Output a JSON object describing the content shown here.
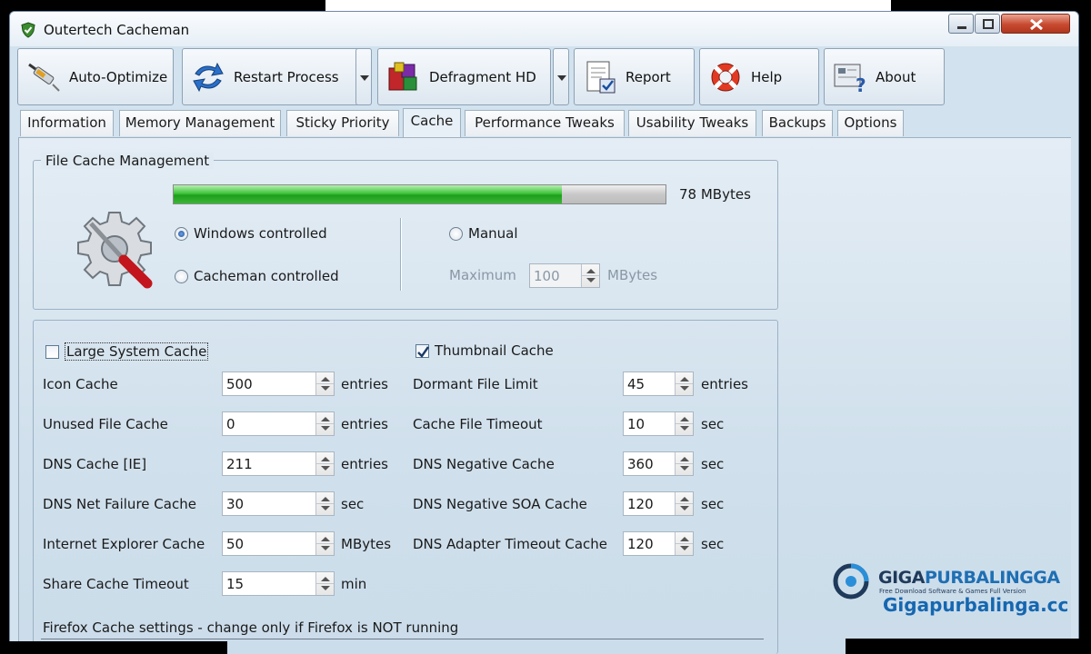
{
  "window": {
    "title": "Outertech Cacheman"
  },
  "toolbar": {
    "auto_optimize": "Auto-Optimize",
    "restart_process": "Restart Process",
    "defragment_hd": "Defragment HD",
    "report": "Report",
    "help": "Help",
    "about": "About"
  },
  "tabs": [
    {
      "label": "Information"
    },
    {
      "label": "Memory Management"
    },
    {
      "label": "Sticky Priority"
    },
    {
      "label": "Cache",
      "active": true
    },
    {
      "label": "Performance Tweaks"
    },
    {
      "label": "Usability Tweaks"
    },
    {
      "label": "Backups"
    },
    {
      "label": "Options"
    }
  ],
  "file_cache": {
    "legend": "File Cache Management",
    "usage_label": "78 MBytes",
    "usage_fraction": 0.79,
    "windows_controlled": "Windows controlled",
    "cacheman_controlled": "Cacheman controlled",
    "manual": "Manual",
    "selected": "windows_controlled",
    "maximum_label": "Maximum",
    "maximum_value": "100",
    "maximum_unit": "MBytes"
  },
  "checkboxes": {
    "large_system_cache": {
      "label": "Large System Cache",
      "checked": false
    },
    "thumbnail_cache": {
      "label": "Thumbnail Cache",
      "checked": true
    }
  },
  "left_settings": [
    {
      "label": "Icon Cache",
      "value": "500",
      "unit": "entries"
    },
    {
      "label": "Unused File Cache",
      "value": "0",
      "unit": "entries"
    },
    {
      "label": "DNS Cache [IE]",
      "value": "211",
      "unit": "entries"
    },
    {
      "label": "DNS Net Failure Cache",
      "value": "30",
      "unit": "sec"
    },
    {
      "label": "Internet Explorer Cache",
      "value": "50",
      "unit": "MBytes"
    },
    {
      "label": "Share Cache Timeout",
      "value": "15",
      "unit": "min"
    }
  ],
  "right_settings": [
    {
      "label": "Dormant File Limit",
      "value": "45",
      "unit": "entries"
    },
    {
      "label": "Cache File Timeout",
      "value": "10",
      "unit": "sec"
    },
    {
      "label": "DNS Negative Cache",
      "value": "360",
      "unit": "sec"
    },
    {
      "label": "DNS Negative SOA Cache",
      "value": "120",
      "unit": "sec"
    },
    {
      "label": "DNS Adapter Timeout Cache",
      "value": "120",
      "unit": "sec"
    }
  ],
  "firefox_note": "Firefox Cache settings - change only if Firefox is NOT running",
  "watermark": {
    "brand_a": "GIGA",
    "brand_b": "PURBALINGGA",
    "tagline": "Free Download Software & Games Full Version",
    "url": "Gigapurbalinga.cc"
  },
  "colors": {
    "progress_green": "#2fb22b",
    "accent_blue": "#1567b0"
  }
}
